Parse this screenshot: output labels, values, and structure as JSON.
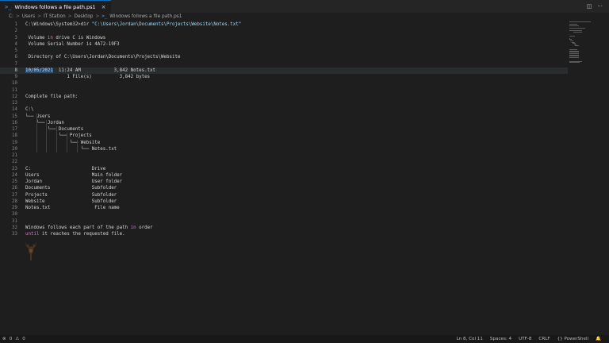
{
  "tab": {
    "icon": ">_",
    "title": "Windows follows a file path.ps1",
    "close": "×"
  },
  "tab_actions": {
    "split": "◫",
    "more": "···"
  },
  "breadcrumb": {
    "items": [
      "C:",
      "Users",
      "IT Station",
      "Desktop"
    ],
    "file_icon": ">_",
    "file": "Windows follows a file path.ps1"
  },
  "editor": {
    "current_line": 8,
    "lines": [
      "C:\\Windows\\System32>dir \"C:\\Users\\Jordan\\Documents\\Projects\\Website\\Notes.txt\"",
      "",
      " Volume in drive C is Windows",
      " Volume Serial Number is 4A72-19F3",
      "",
      " Directory of C:\\Users\\Jordan\\Documents\\Projects\\Website",
      "",
      "10/05/2021  11:24 AM            3,842 Notes.txt",
      "               1 File(s)          3,842 bytes",
      "",
      "",
      "Complete file path:",
      "",
      "C:\\",
      "└── Users",
      "    └── Jordan",
      "        └── Documents",
      "            └── Projects",
      "                └── Website",
      "                    └── Notes.txt",
      "",
      "",
      "C:                      Drive",
      "Users                   Main folder",
      "Jordan                  User folder",
      "Documents               Subfolder",
      "Projects                Subfolder",
      "Website                 Subfolder",
      "Notes.txt                File name",
      "",
      "",
      "Windows follows each part of the path in order",
      "until it reaches the requested file."
    ]
  },
  "status": {
    "remote_icon": "⊗",
    "errors": "0",
    "warnings_icon": "⚠",
    "warnings": "0",
    "cursor": "Ln 8, Col 11",
    "spaces": "Spaces: 4",
    "encoding": "UTF-8",
    "eol": "CRLF",
    "language": "{} PowerShell",
    "bell_icon": "🔔"
  }
}
